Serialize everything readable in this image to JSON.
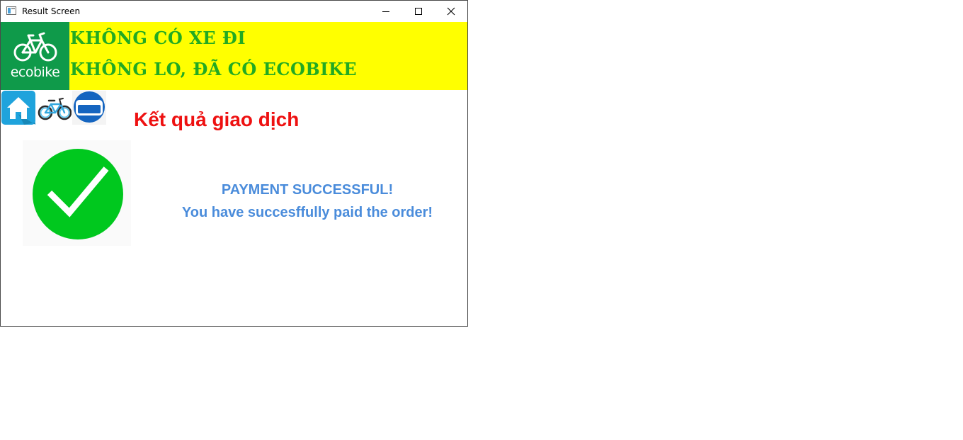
{
  "window": {
    "title": "Result Screen"
  },
  "banner": {
    "logo_text": "ecobike",
    "slogan_line1": "KHÔNG CÓ XE ĐI",
    "slogan_line2": "KHÔNG LO, ĐÃ CÓ ECOBIKE",
    "background_color": "#ffff00",
    "slogan_color": "#22aa22",
    "logo_color": "#0f9a4a"
  },
  "nav": {
    "items": [
      {
        "icon": "home-icon"
      },
      {
        "icon": "bike-icon"
      },
      {
        "icon": "card-icon"
      }
    ]
  },
  "main": {
    "title": "Kết quả giao dịch",
    "status_icon": "check-circle-icon",
    "result_title": "PAYMENT SUCCESSFUL!",
    "result_message": "You have succesffully paid the order!",
    "title_color": "#ee1111",
    "message_color": "#4a8cdb",
    "success_color": "#00c81e"
  }
}
